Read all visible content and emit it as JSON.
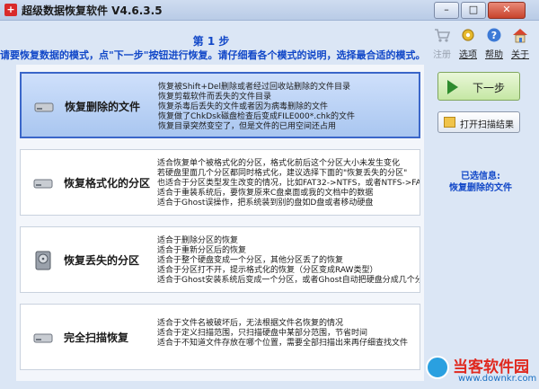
{
  "window": {
    "title": "超级数据恢复软件 V4.6.3.5",
    "app_icon_glyph": "+",
    "minimize": "–",
    "maximize": "□",
    "close": "✕"
  },
  "header": {
    "step": "第 1 步",
    "instructions": "请要恢复数据的模式，点\"下一步\"按钮进行恢复。请仔细看各个模式的说明，选择最合适的模式。"
  },
  "toolbar": {
    "register": "注册",
    "options": "选项",
    "help": "帮助",
    "about": "关于"
  },
  "modes": [
    {
      "name": "恢复删除的文件",
      "selected": true,
      "lines": [
        "恢复被Shift+Del删除或者经过回收站删除的文件目录",
        "恢复剪载软件而丢失的文件目录",
        "恢复杀毒后丢失的文件或者因为病毒删除的文件",
        "恢复做了ChkDsk磁盘检查后变成FILE000*.chk的文件",
        "恢复目录突然变空了，但是文件的已用空间还占用"
      ]
    },
    {
      "name": "恢复格式化的分区",
      "selected": false,
      "lines": [
        "适合恢复单个被格式化的分区，格式化前后这个分区大小未发生变化",
        "若硬盘里面几个分区都同时格式化，建议选择下面的\"恢复丢失的分区\"",
        "也适合于分区类型发生改变的情况，比如FAT32->NTFS，或者NTFS->FAT3",
        "适合于重装系统后，要恢复原来C盘桌面或我的文档中的数据",
        "适合于Ghost误操作，把系统装到别的盘如D盘或者移动硬盘"
      ]
    },
    {
      "name": "恢复丢失的分区",
      "selected": false,
      "lines": [
        "适合于删除分区的恢复",
        "适合于重新分区后的恢复",
        "适合于整个硬盘变成一个分区，其他分区丢了的恢复",
        "适合于分区打不开，提示格式化的恢复（分区变成RAW类型）",
        "适合于Ghost安装系统后变成一个分区，或者Ghost自动把硬盘分成几个分"
      ]
    },
    {
      "name": "完全扫描恢复",
      "selected": false,
      "lines": [
        "适合于文件名被破坏后，无法根据文件名恢复的情况",
        "适合于定义扫描范围，只扫描硬盘中某部分范围，节省时间",
        "适合于不知道文件存放在哪个位置，需要全部扫描出来再仔细查找文件"
      ]
    }
  ],
  "actions": {
    "next": "下一步",
    "open_scan": "打开扫描结果"
  },
  "selected_info": {
    "label": "已选信息:",
    "value": "恢复删除的文件"
  },
  "watermark": {
    "site": "当客软件园",
    "url": "www.downkr.com"
  },
  "colors": {
    "accent_text": "#1248c8",
    "selected_bg": "#a9c6f0",
    "next_green": "#2e8b2e"
  }
}
